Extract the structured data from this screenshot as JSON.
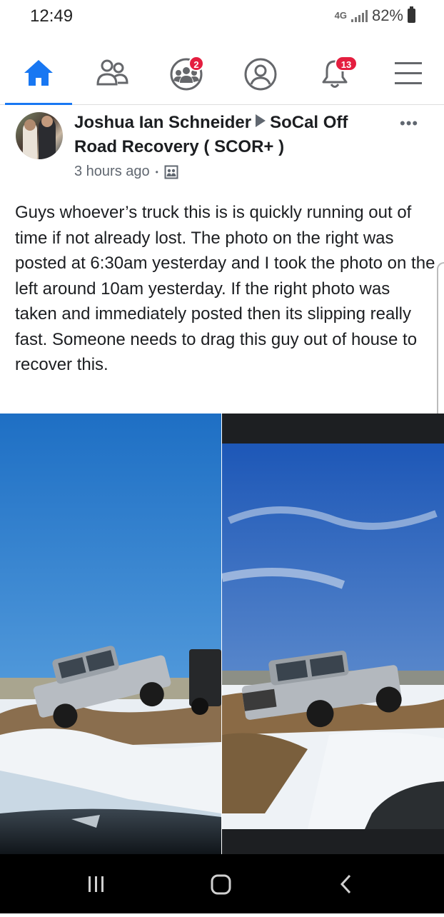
{
  "status_bar": {
    "time": "12:49",
    "network": "4G",
    "battery": "82%"
  },
  "nav": {
    "items": [
      {
        "icon": "home-icon",
        "active": true
      },
      {
        "icon": "friends-icon"
      },
      {
        "icon": "groups-icon",
        "badge": "2"
      },
      {
        "icon": "profile-icon"
      },
      {
        "icon": "notifications-icon",
        "badge": "13"
      },
      {
        "icon": "menu-icon"
      }
    ],
    "accent": "#1877f2",
    "badge_color": "#e41e3f"
  },
  "post": {
    "author": "Joshua Ian Schneider",
    "group": "SoCal Off Road Recovery ( SCOR+ )",
    "time": "3 hours ago",
    "privacy_icon": "group-privacy-icon",
    "text": "Guys whoever’s truck this is is quickly running out of time if not already lost.  The photo on the right was posted at 6:30am yesterday and I took the photo on the left around 10am yesterday.  If the right photo was taken and immediately posted then its slipping really fast.  Someone needs to drag this guy out of house to recover this."
  },
  "system_nav": {
    "buttons": [
      "recent-apps-icon",
      "home-button-icon",
      "back-icon"
    ]
  }
}
